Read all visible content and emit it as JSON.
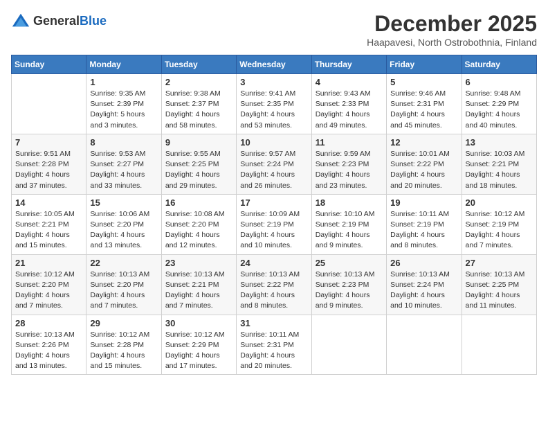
{
  "header": {
    "logo_general": "General",
    "logo_blue": "Blue",
    "month_year": "December 2025",
    "location": "Haapavesi, North Ostrobothnia, Finland"
  },
  "calendar": {
    "days_of_week": [
      "Sunday",
      "Monday",
      "Tuesday",
      "Wednesday",
      "Thursday",
      "Friday",
      "Saturday"
    ],
    "weeks": [
      [
        {
          "day": "",
          "info": ""
        },
        {
          "day": "1",
          "info": "Sunrise: 9:35 AM\nSunset: 2:39 PM\nDaylight: 5 hours\nand 3 minutes."
        },
        {
          "day": "2",
          "info": "Sunrise: 9:38 AM\nSunset: 2:37 PM\nDaylight: 4 hours\nand 58 minutes."
        },
        {
          "day": "3",
          "info": "Sunrise: 9:41 AM\nSunset: 2:35 PM\nDaylight: 4 hours\nand 53 minutes."
        },
        {
          "day": "4",
          "info": "Sunrise: 9:43 AM\nSunset: 2:33 PM\nDaylight: 4 hours\nand 49 minutes."
        },
        {
          "day": "5",
          "info": "Sunrise: 9:46 AM\nSunset: 2:31 PM\nDaylight: 4 hours\nand 45 minutes."
        },
        {
          "day": "6",
          "info": "Sunrise: 9:48 AM\nSunset: 2:29 PM\nDaylight: 4 hours\nand 40 minutes."
        }
      ],
      [
        {
          "day": "7",
          "info": "Sunrise: 9:51 AM\nSunset: 2:28 PM\nDaylight: 4 hours\nand 37 minutes."
        },
        {
          "day": "8",
          "info": "Sunrise: 9:53 AM\nSunset: 2:27 PM\nDaylight: 4 hours\nand 33 minutes."
        },
        {
          "day": "9",
          "info": "Sunrise: 9:55 AM\nSunset: 2:25 PM\nDaylight: 4 hours\nand 29 minutes."
        },
        {
          "day": "10",
          "info": "Sunrise: 9:57 AM\nSunset: 2:24 PM\nDaylight: 4 hours\nand 26 minutes."
        },
        {
          "day": "11",
          "info": "Sunrise: 9:59 AM\nSunset: 2:23 PM\nDaylight: 4 hours\nand 23 minutes."
        },
        {
          "day": "12",
          "info": "Sunrise: 10:01 AM\nSunset: 2:22 PM\nDaylight: 4 hours\nand 20 minutes."
        },
        {
          "day": "13",
          "info": "Sunrise: 10:03 AM\nSunset: 2:21 PM\nDaylight: 4 hours\nand 18 minutes."
        }
      ],
      [
        {
          "day": "14",
          "info": "Sunrise: 10:05 AM\nSunset: 2:21 PM\nDaylight: 4 hours\nand 15 minutes."
        },
        {
          "day": "15",
          "info": "Sunrise: 10:06 AM\nSunset: 2:20 PM\nDaylight: 4 hours\nand 13 minutes."
        },
        {
          "day": "16",
          "info": "Sunrise: 10:08 AM\nSunset: 2:20 PM\nDaylight: 4 hours\nand 12 minutes."
        },
        {
          "day": "17",
          "info": "Sunrise: 10:09 AM\nSunset: 2:19 PM\nDaylight: 4 hours\nand 10 minutes."
        },
        {
          "day": "18",
          "info": "Sunrise: 10:10 AM\nSunset: 2:19 PM\nDaylight: 4 hours\nand 9 minutes."
        },
        {
          "day": "19",
          "info": "Sunrise: 10:11 AM\nSunset: 2:19 PM\nDaylight: 4 hours\nand 8 minutes."
        },
        {
          "day": "20",
          "info": "Sunrise: 10:12 AM\nSunset: 2:19 PM\nDaylight: 4 hours\nand 7 minutes."
        }
      ],
      [
        {
          "day": "21",
          "info": "Sunrise: 10:12 AM\nSunset: 2:20 PM\nDaylight: 4 hours\nand 7 minutes."
        },
        {
          "day": "22",
          "info": "Sunrise: 10:13 AM\nSunset: 2:20 PM\nDaylight: 4 hours\nand 7 minutes."
        },
        {
          "day": "23",
          "info": "Sunrise: 10:13 AM\nSunset: 2:21 PM\nDaylight: 4 hours\nand 7 minutes."
        },
        {
          "day": "24",
          "info": "Sunrise: 10:13 AM\nSunset: 2:22 PM\nDaylight: 4 hours\nand 8 minutes."
        },
        {
          "day": "25",
          "info": "Sunrise: 10:13 AM\nSunset: 2:23 PM\nDaylight: 4 hours\nand 9 minutes."
        },
        {
          "day": "26",
          "info": "Sunrise: 10:13 AM\nSunset: 2:24 PM\nDaylight: 4 hours\nand 10 minutes."
        },
        {
          "day": "27",
          "info": "Sunrise: 10:13 AM\nSunset: 2:25 PM\nDaylight: 4 hours\nand 11 minutes."
        }
      ],
      [
        {
          "day": "28",
          "info": "Sunrise: 10:13 AM\nSunset: 2:26 PM\nDaylight: 4 hours\nand 13 minutes."
        },
        {
          "day": "29",
          "info": "Sunrise: 10:12 AM\nSunset: 2:28 PM\nDaylight: 4 hours\nand 15 minutes."
        },
        {
          "day": "30",
          "info": "Sunrise: 10:12 AM\nSunset: 2:29 PM\nDaylight: 4 hours\nand 17 minutes."
        },
        {
          "day": "31",
          "info": "Sunrise: 10:11 AM\nSunset: 2:31 PM\nDaylight: 4 hours\nand 20 minutes."
        },
        {
          "day": "",
          "info": ""
        },
        {
          "day": "",
          "info": ""
        },
        {
          "day": "",
          "info": ""
        }
      ]
    ]
  }
}
